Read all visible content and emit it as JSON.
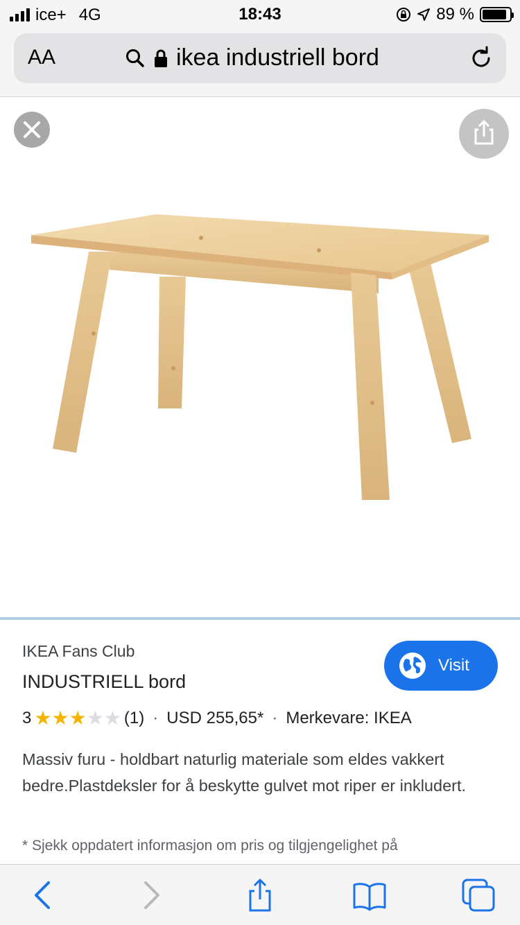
{
  "status_bar": {
    "carrier": "ice+",
    "network": "4G",
    "time": "18:43",
    "battery_text": "89 %",
    "battery_level": 0.89
  },
  "url_bar": {
    "text_size_label": "AA",
    "query": "ikea industriell bord"
  },
  "product": {
    "site": "IKEA Fans Club",
    "title": "INDUSTRIELL bord",
    "visit_label": "Visit",
    "rating_value": "3",
    "rating_stars": 3,
    "rating_max": 5,
    "review_count": "(1)",
    "price": "USD 255,65*",
    "brand": "Merkevare: IKEA",
    "description": "Massiv furu - holdbart naturlig materiale som eldes vakkert bedre.Plastdeksler for å beskytte gulvet mot riper er inkludert.",
    "footnote": "* Sjekk oppdatert informasjon om pris og tilgjengelighet på"
  },
  "colors": {
    "accent": "#1a73e8",
    "star_filled": "#f4b400",
    "star_empty": "#dadce0",
    "toolbar_icon": "#1a73e8"
  },
  "icons": {
    "close": "close-icon",
    "share": "share-icon",
    "visit": "globe-icon",
    "back": "back-chevron-icon",
    "forward": "forward-chevron-icon",
    "bookmarks": "book-icon",
    "tabs": "tabs-icon"
  }
}
